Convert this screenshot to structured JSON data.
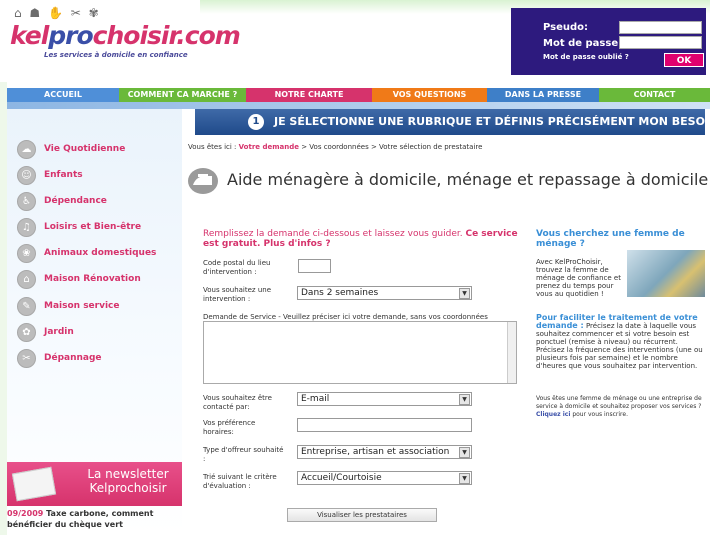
{
  "header": {
    "logo_icons": "⌂ ☗ ✋ ✂ ✾",
    "logo_k": "kel",
    "logo_p": "pro",
    "logo_c": "choisir.com",
    "logo_tagline": "Les services à domicile en confiance",
    "login": {
      "pseudo_label": "Pseudo:",
      "password_label": "Mot de passe:",
      "forgot": "Mot de passe oublié ?",
      "ok": "OK"
    }
  },
  "nav": [
    {
      "label": "ACCUEIL",
      "color": "#4f8fd8"
    },
    {
      "label": "COMMENT CA MARCHE ?",
      "color": "#6ab93a"
    },
    {
      "label": "NOTRE CHARTE",
      "color": "#d6336c"
    },
    {
      "label": "VOS QUESTIONS",
      "color": "#f07a18"
    },
    {
      "label": "DANS LA PRESSE",
      "color": "#3e7fc8"
    },
    {
      "label": "CONTACT",
      "color": "#6ab93a"
    }
  ],
  "sidebar": {
    "items": [
      {
        "label": "Vie Quotidienne",
        "icon": "☁"
      },
      {
        "label": "Enfants",
        "icon": "☺"
      },
      {
        "label": "Dépendance",
        "icon": "♿"
      },
      {
        "label": "Loisirs et Bien-être",
        "icon": "♫"
      },
      {
        "label": "Animaux domestiques",
        "icon": "❀"
      },
      {
        "label": "Maison Rénovation",
        "icon": "⌂"
      },
      {
        "label": "Maison service",
        "icon": "✎"
      },
      {
        "label": "Jardin",
        "icon": "✿"
      },
      {
        "label": "Dépannage",
        "icon": "✂"
      }
    ],
    "newsletter_title": "La newsletter Kelprochoisir",
    "news_date": "09/2009",
    "news_text": "Taxe carbone, comment bénéficier du chèque vert"
  },
  "step": {
    "number": "1",
    "text": "JE SÉLECTIONNE UNE RUBRIQUE ET DÉFINIS PRÉCISÉMENT MON BESOIN"
  },
  "breadcrumb": {
    "prefix": "Vous êtes ici : ",
    "current": "Votre demande",
    "rest": " > Vos coordonnées > Votre sélection de prestataire"
  },
  "page_title": "Aide ménagère à domicile, ménage et repassage à domicile",
  "form": {
    "intro": "Remplissez la demande ci-dessous et laissez vous guider. ",
    "intro_bold": "Ce service est gratuit. Plus d'infos ?",
    "postal_label": "Code postal du lieu d'intervention :",
    "postal_value": "",
    "when_label": "Vous souhaitez une intervention :",
    "when_value": "Dans 2 semaines",
    "desc_label": "Demande de Service - Veuillez préciser ici votre demande, sans vos coordonnées",
    "contact_label": "Vous souhaitez être contacté par:",
    "contact_value": "E-mail",
    "hours_label": "Vos préférence horaires:",
    "hours_value": "",
    "offer_label": "Type d'offreur souhaité :",
    "offer_value": "Entreprise, artisan et association",
    "sort_label": "Trié suivant le critère d'évaluation :",
    "sort_value": "Accueil/Courtoisie",
    "submit": "Visualiser les prestataires"
  },
  "right": {
    "title": "Vous cherchez une femme de ménage ?",
    "para1": "Avec KelProChoisir, trouvez la femme de ménage de confiance et prenez du temps pour vous au quotidien !",
    "sub_bold": "Pour faciliter le traitement de votre demande :",
    "sub_text": " Précisez la date à laquelle vous souhaitez commencer et si votre besoin est ponctuel (remise à niveau) ou récurrent. Précisez la fréquence des interventions (une ou plusieurs fois par semaine) et le nombre d'heures que vous souhaitez par intervention.",
    "para3": "Vous êtes une femme de ménage ou une entreprise de service à domicile et souhaitez proposer vos services ? ",
    "para3_bold": "Cliquez ici",
    "para3_end": " pour vous inscrire."
  },
  "colors": {
    "accent_pink": "#d6336c",
    "brand_blue": "#3a4fa8",
    "login_bg": "#2d1a7e",
    "banner_blue": "#1f4a8a"
  }
}
